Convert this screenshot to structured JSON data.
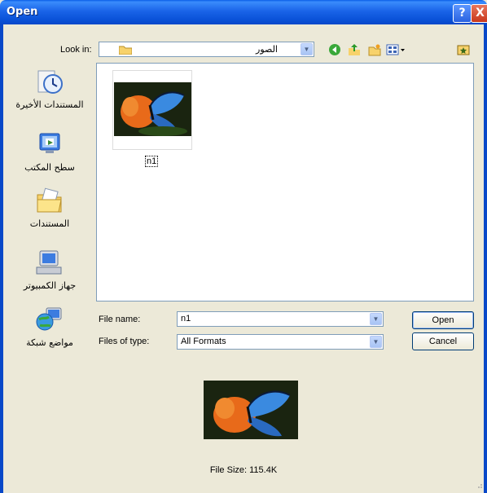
{
  "window": {
    "title": "Open",
    "help_label": "?",
    "close_label": "X"
  },
  "look_in": {
    "label": "Look in:",
    "value": "الصور"
  },
  "toolbar": {
    "icons": [
      "back-icon",
      "up-folder-icon",
      "new-folder-icon",
      "views-menu-icon",
      "desktop-shortcut-icon"
    ]
  },
  "places": [
    {
      "label": "المستندات الأخيرة",
      "icon": "recent-documents-icon"
    },
    {
      "label": "سطح المكتب",
      "icon": "desktop-icon"
    },
    {
      "label": "المستندات",
      "icon": "documents-icon"
    },
    {
      "label": "جهاز الكمبيوتر",
      "icon": "my-computer-icon"
    },
    {
      "label": "مواضع شبكة",
      "icon": "network-places-icon"
    }
  ],
  "files": [
    {
      "name": "n1",
      "icon": "butterfly-thumbnail"
    }
  ],
  "file_name": {
    "label": "File name:",
    "value": "n1"
  },
  "file_type": {
    "label": "Files of type:",
    "value": "All Formats"
  },
  "buttons": {
    "open": "Open",
    "cancel": "Cancel"
  },
  "preview": {
    "file_size": "File Size: 115.4K"
  },
  "colors": {
    "title_bar": "#0a52d8",
    "dialog_bg": "#ece9d8",
    "border": "#7f9db9"
  }
}
